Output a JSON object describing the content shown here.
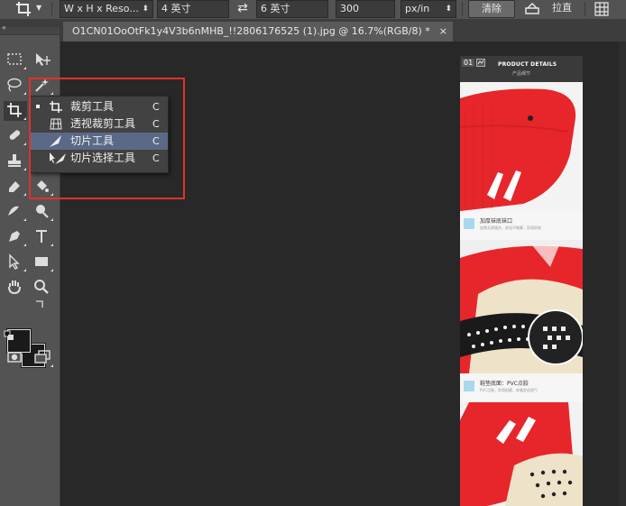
{
  "options_bar": {
    "ratio_select": "W x H x Reso...",
    "width_value": "4 英寸",
    "height_value": "6 英寸",
    "resolution_value": "300",
    "unit_select": "px/in",
    "clear_label": "清除",
    "straighten_label": "拉直"
  },
  "document_tab": {
    "title": "O1CN01OoOtFk1y4V3b6nMHB_!!2806176525 (1).jpg @ 16.7%(RGB/8) *",
    "close_glyph": "×"
  },
  "flyout": {
    "items": [
      {
        "label": "裁剪工具",
        "shortcut": "C",
        "active": true
      },
      {
        "label": "透视裁剪工具",
        "shortcut": "C",
        "active": false
      },
      {
        "label": "切片工具",
        "shortcut": "C",
        "active": false
      },
      {
        "label": "切片选择工具",
        "shortcut": "C",
        "active": false
      }
    ],
    "highlighted_index": 2
  },
  "canvas": {
    "slice_number": "01",
    "header_title": "PRODUCT DETAILS",
    "header_subtitle": "产品细节",
    "band1_title": "加厚袜底袜口",
    "band1_text": "加厚无骨缝合，舒适不勒脚，防滑耐穿",
    "band2_title": "鞋垫底面：PVC点胶",
    "band2_text": "PVC点胶，防滑耐磨，穿着舒适透气"
  },
  "colors": {
    "highlight": "#5a6a86",
    "annotation_red": "#e0312c",
    "sock_red": "#e6262a"
  },
  "icons": [
    "crop-icon",
    "swap-icon",
    "move-icon",
    "marquee-icon",
    "lasso-icon",
    "magic-wand-icon",
    "healing-brush-icon",
    "brush-icon",
    "clone-stamp-icon",
    "history-brush-icon",
    "eraser-icon",
    "paint-bucket-icon",
    "blur-icon",
    "dodge-icon",
    "pen-icon",
    "type-icon",
    "path-selection-icon",
    "rectangle-icon",
    "hand-icon",
    "zoom-icon",
    "quick-mask-icon",
    "screen-mode-icon",
    "grid-icon"
  ]
}
